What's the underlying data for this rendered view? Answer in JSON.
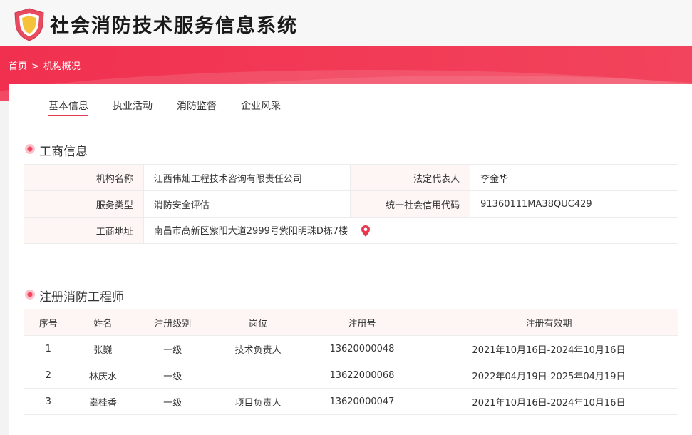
{
  "header": {
    "site_title": "社会消防技术服务信息系统",
    "logo_icon": "shield-logo-icon"
  },
  "breadcrumb": {
    "home": "首页",
    "separator": ">",
    "current": "机构概况"
  },
  "tabs": [
    {
      "label": "基本信息",
      "active": true
    },
    {
      "label": "执业活动",
      "active": false
    },
    {
      "label": "消防监督",
      "active": false
    },
    {
      "label": "企业风采",
      "active": false
    }
  ],
  "business_info": {
    "title": "工商信息",
    "org_name_label": "机构名称",
    "org_name": "江西伟灿工程技术咨询有限责任公司",
    "legal_rep_label": "法定代表人",
    "legal_rep": "李金华",
    "service_type_label": "服务类型",
    "service_type": "消防安全评估",
    "credit_code_label": "统一社会信用代码",
    "credit_code": "91360111MA38QUC429",
    "address_label": "工商地址",
    "address": "南昌市高新区紫阳大道2999号紫阳明珠D栋7楼",
    "map_icon": "map-pin-icon"
  },
  "engineers": {
    "title": "注册消防工程师",
    "columns": [
      "序号",
      "姓名",
      "注册级别",
      "岗位",
      "注册号",
      "注册有效期"
    ],
    "rows": [
      {
        "no": "1",
        "name": "张巍",
        "level": "一级",
        "post": "技术负责人",
        "reg_no": "13620000048",
        "valid": "2021年10月16日-2024年10月16日"
      },
      {
        "no": "2",
        "name": "林庆水",
        "level": "一级",
        "post": "",
        "reg_no": "13622000068",
        "valid": "2022年04月19日-2025年04月19日"
      },
      {
        "no": "3",
        "name": "辜桂香",
        "level": "一级",
        "post": "项目负责人",
        "reg_no": "13620000047",
        "valid": "2021年10月16日-2024年10月16日"
      }
    ]
  },
  "colors": {
    "accent": "#e83a52",
    "banner": "#f1304f",
    "label_bg": "#fdf6f5"
  }
}
